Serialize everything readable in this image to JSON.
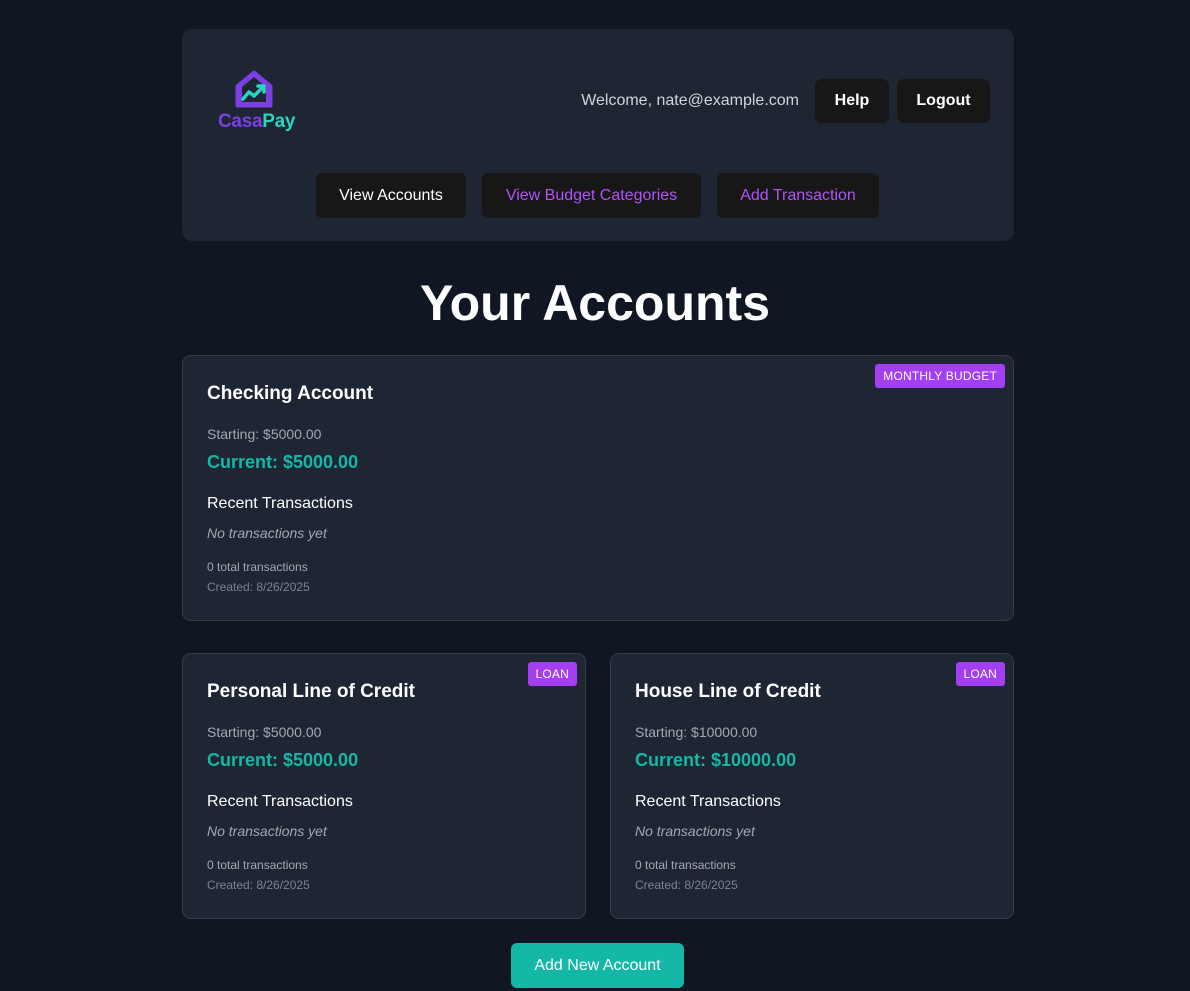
{
  "app": {
    "logo_text_part1": "Casa",
    "logo_text_part2": "Pay",
    "logo_icon": "house-chart-icon",
    "brand_purple": "#7b3fe4",
    "brand_teal": "#2dd4bf"
  },
  "header": {
    "welcome_text": "Welcome, nate@example.com",
    "help_label": "Help",
    "logout_label": "Logout"
  },
  "nav": {
    "view_accounts_label": "View Accounts",
    "view_budget_categories_label": "View Budget Categories",
    "add_transaction_label": "Add Transaction",
    "accent_color": "#b153f7"
  },
  "main": {
    "title": "Your Accounts",
    "add_account_label": "Add New Account",
    "badge_color": "#a33ff0",
    "current_color": "#14b8a6"
  },
  "accounts": [
    {
      "name": "Checking Account",
      "badge": "MONTHLY BUDGET",
      "starting": "Starting: $5000.00",
      "current": "Current: $5000.00",
      "recent_label": "Recent Transactions",
      "empty_text": "No transactions yet",
      "total_transactions": "0 total transactions",
      "created": "Created: 8/26/2025"
    },
    {
      "name": "Personal Line of Credit",
      "badge": "LOAN",
      "starting": "Starting: $5000.00",
      "current": "Current: $5000.00",
      "recent_label": "Recent Transactions",
      "empty_text": "No transactions yet",
      "total_transactions": "0 total transactions",
      "created": "Created: 8/26/2025"
    },
    {
      "name": "House Line of Credit",
      "badge": "LOAN",
      "starting": "Starting: $10000.00",
      "current": "Current: $10000.00",
      "recent_label": "Recent Transactions",
      "empty_text": "No transactions yet",
      "total_transactions": "0 total transactions",
      "created": "Created: 8/26/2025"
    }
  ]
}
